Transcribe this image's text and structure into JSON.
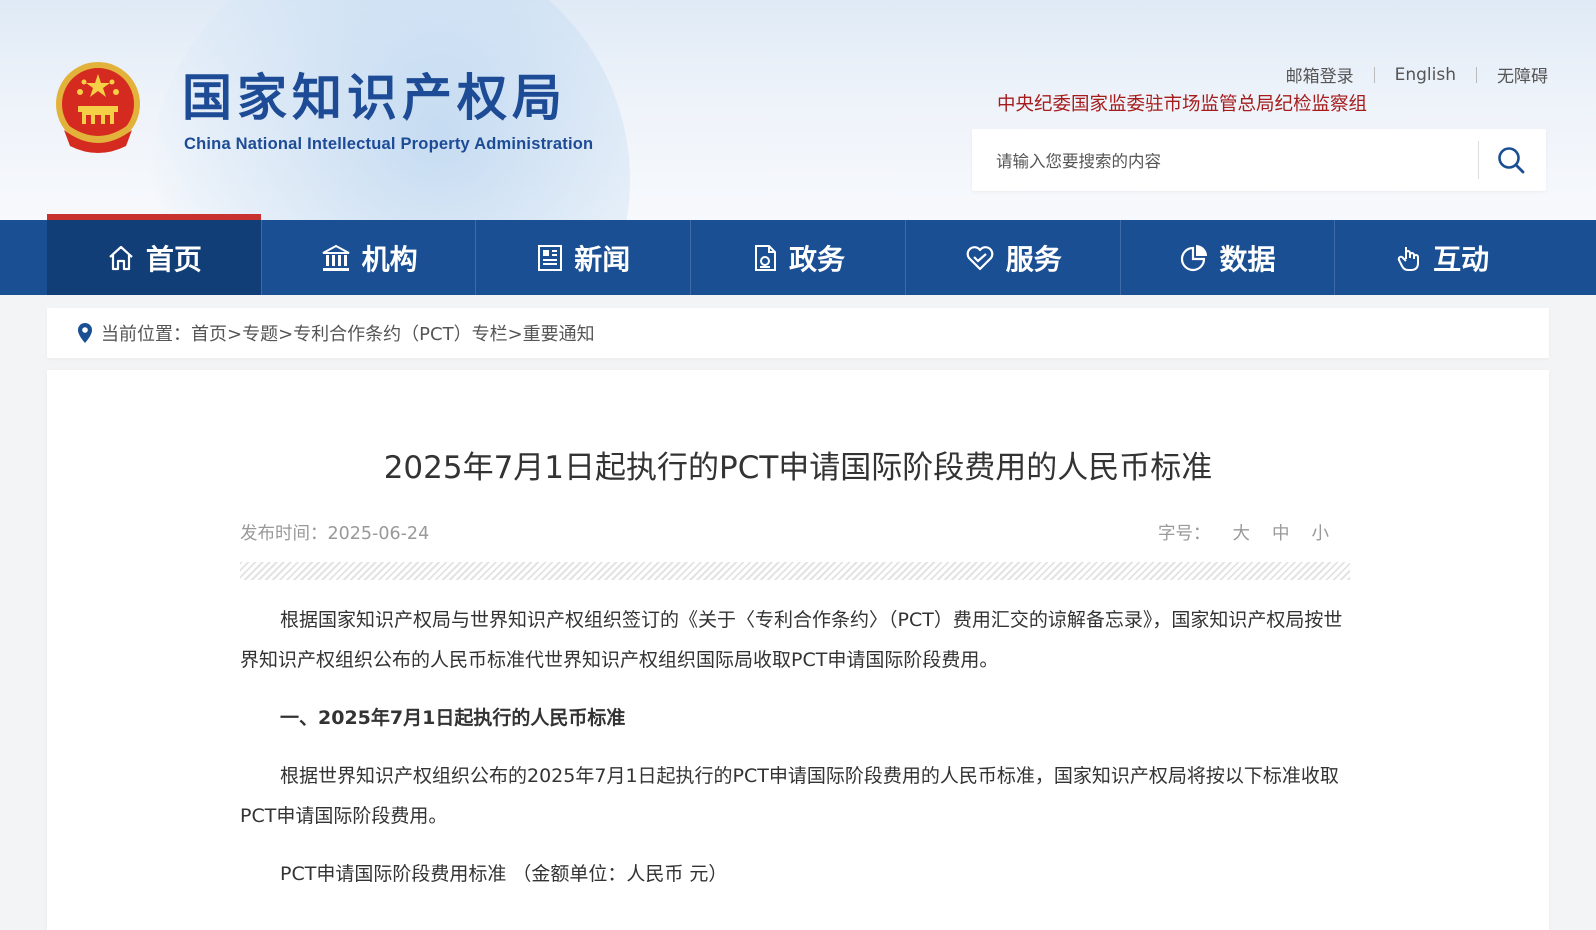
{
  "header": {
    "logo_cn": "国家知识产权局",
    "logo_en": "China National Intellectual Property Administration",
    "links": [
      "邮箱登录",
      "English",
      "无障碍"
    ],
    "discipline": "中央纪委国家监委驻市场监管总局纪检监察组",
    "search": {
      "placeholder": "请输入您要搜索的内容"
    }
  },
  "nav": [
    {
      "label": "首页",
      "icon": "home-icon",
      "active": true
    },
    {
      "label": "机构",
      "icon": "institution-icon"
    },
    {
      "label": "新闻",
      "icon": "news-icon"
    },
    {
      "label": "政务",
      "icon": "document-icon"
    },
    {
      "label": "服务",
      "icon": "service-heart-icon"
    },
    {
      "label": "数据",
      "icon": "pie-chart-icon"
    },
    {
      "label": "互动",
      "icon": "hand-pointer-icon"
    }
  ],
  "breadcrumb": "当前位置：首页>专题>专利合作条约（PCT）专栏>重要通知",
  "article": {
    "title": "2025年7月1日起执行的PCT申请国际阶段费用的人民币标准",
    "publish_time": "发布时间：2025-06-24",
    "font_size_label": "字号：",
    "font_sizes": [
      "大",
      "中",
      "小"
    ],
    "paragraphs": [
      "根据国家知识产权局与世界知识产权组织签订的《关于〈专利合作条约〉（PCT）费用汇交的谅解备忘录》，国家知识产权局按世界知识产权组织公布的人民币标准代世界知识产权组织国际局收取PCT申请国际阶段费用。",
      "一、2025年7月1日起执行的人民币标准",
      "根据世界知识产权组织公布的2025年7月1日起执行的PCT申请国际阶段费用的人民币标准，国家知识产权局将按以下标准收取PCT申请国际阶段费用。",
      "PCT申请国际阶段费用标准 （金额单位：人民币 元）"
    ]
  },
  "colors": {
    "nav": "#1b4f93",
    "nav_active": "#123e78",
    "logo": "#1d4b95",
    "accent_red": "#a61c1c"
  }
}
